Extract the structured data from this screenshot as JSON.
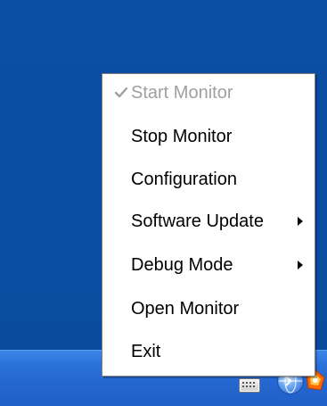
{
  "menu": {
    "items": [
      {
        "label": "Start Monitor",
        "checked": true,
        "disabled": true,
        "submenu": false
      },
      {
        "label": "Stop Monitor",
        "checked": false,
        "disabled": false,
        "submenu": false
      },
      {
        "label": "Configuration",
        "checked": false,
        "disabled": false,
        "submenu": false
      },
      {
        "label": "Software Update",
        "checked": false,
        "disabled": false,
        "submenu": true
      },
      {
        "label": "Debug Mode",
        "checked": false,
        "disabled": false,
        "submenu": true
      },
      {
        "label": "Open Monitor",
        "checked": false,
        "disabled": false,
        "submenu": false
      },
      {
        "label": "Exit",
        "checked": false,
        "disabled": false,
        "submenu": false
      }
    ]
  },
  "icons": {
    "checkmark": "check-icon",
    "submenu_arrow": "submenu-arrow-icon",
    "tray": [
      "keyboard-icon",
      "network-globe-icon",
      "monitor-app-icon"
    ]
  },
  "colors": {
    "desktop_background": "#0a4fa3",
    "taskbar": "#2466cf",
    "menu_background": "#ffffff",
    "menu_text": "#000000",
    "disabled_text": "#a0a0a0"
  }
}
